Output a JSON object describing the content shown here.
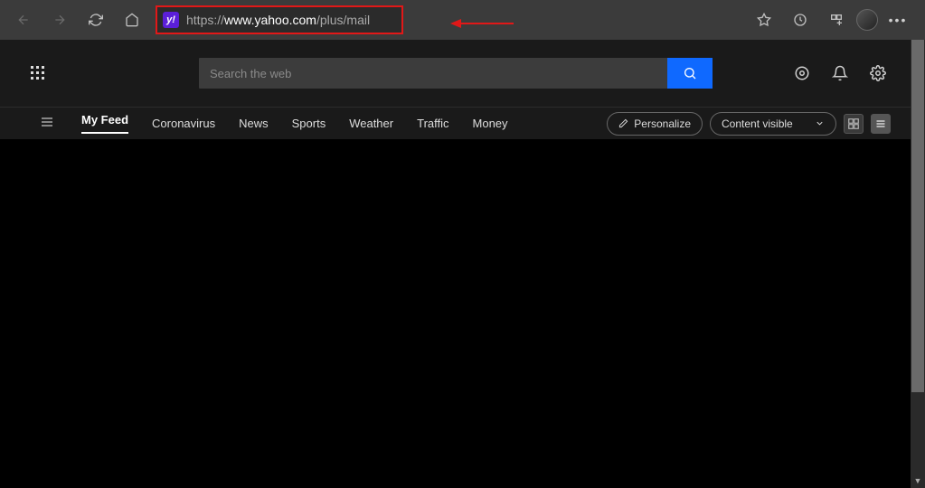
{
  "browser": {
    "url_proto": "https://",
    "url_domain": "www.yahoo.com",
    "url_path": "/plus/mail",
    "favicon_letter": "y!"
  },
  "search": {
    "placeholder": "Search the web"
  },
  "feed": {
    "links": [
      "My Feed",
      "Coronavirus",
      "News",
      "Sports",
      "Weather",
      "Traffic",
      "Money"
    ],
    "active_index": 0,
    "personalize": "Personalize",
    "content_visible": "Content visible"
  }
}
